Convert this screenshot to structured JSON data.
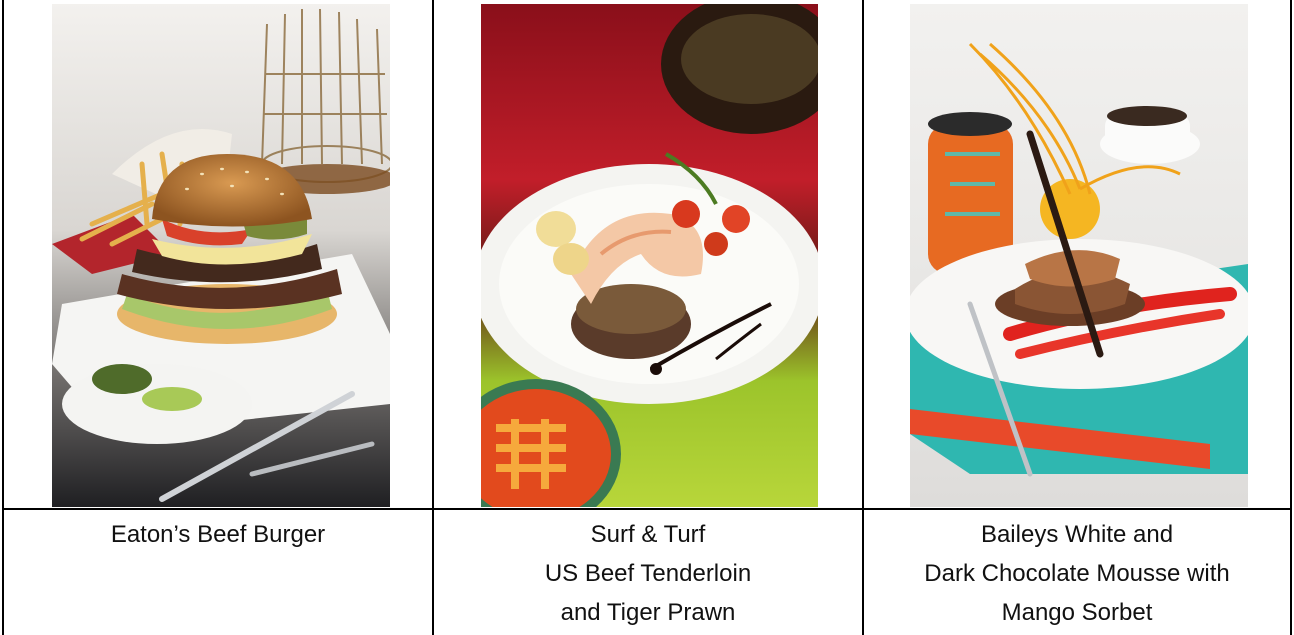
{
  "dishes": [
    {
      "name": "eatons-beef-burger",
      "caption_lines": [
        "Eaton’s Beef Burger"
      ]
    },
    {
      "name": "surf-and-turf",
      "caption_lines": [
        "Surf & Turf",
        "US Beef Tenderloin",
        "and Tiger Prawn"
      ]
    },
    {
      "name": "baileys-mousse",
      "caption_lines": [
        "Baileys White and",
        "Dark Chocolate Mousse with",
        "Mango Sorbet"
      ]
    }
  ]
}
